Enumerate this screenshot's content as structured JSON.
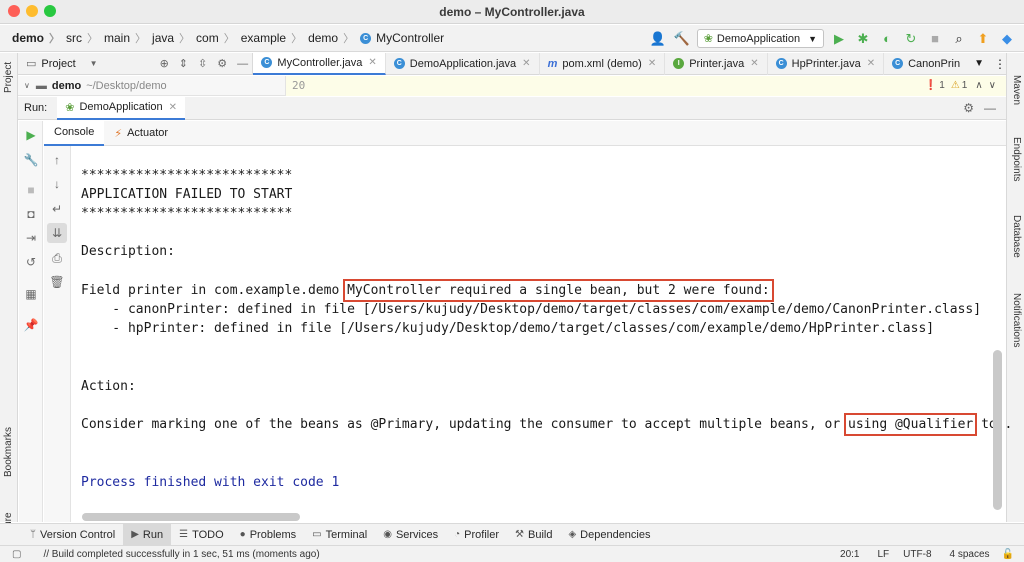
{
  "window": {
    "title": "demo – MyController.java"
  },
  "breadcrumb": [
    "demo",
    "src",
    "main",
    "java",
    "com",
    "example",
    "demo",
    "MyController"
  ],
  "run_config": {
    "label": "DemoApplication"
  },
  "project_panel": {
    "label": "Project",
    "root_name": "demo",
    "root_path": "~/Desktop/demo"
  },
  "editor_tabs": [
    {
      "label": "MyController.java",
      "icon": "C",
      "color": "#3b8fd6",
      "active": true
    },
    {
      "label": "DemoApplication.java",
      "icon": "C",
      "color": "#3b8fd6",
      "active": false
    },
    {
      "label": "pom.xml (demo)",
      "icon": "m",
      "color": "#3b6fd6",
      "active": false
    },
    {
      "label": "Printer.java",
      "icon": "I",
      "color": "#5aa83f",
      "active": false
    },
    {
      "label": "HpPrinter.java",
      "icon": "C",
      "color": "#3b8fd6",
      "active": false
    },
    {
      "label": "CanonPrin",
      "icon": "C",
      "color": "#3b8fd6",
      "active": false
    }
  ],
  "editor": {
    "line_number": "20",
    "errors": "1",
    "warnings": "1"
  },
  "run_panel": {
    "label": "Run:",
    "tab": "DemoApplication",
    "console_tab": "Console",
    "actuator_tab": "Actuator"
  },
  "console": {
    "lines": {
      "stars1": "***************************",
      "failed": "APPLICATION FAILED TO START",
      "stars2": "***************************",
      "desc": "Description:",
      "field_prefix": "Field printer in com.example.demo ",
      "field_highlight": "MyController required a single bean, but 2 were found:",
      "canon": "    - canonPrinter: defined in file [/Users/kujudy/Desktop/demo/target/classes/com/example/demo/CanonPrinter.class]",
      "hp": "    - hpPrinter: defined in file [/Users/kujudy/Desktop/demo/target/classes/com/example/demo/HpPrinter.class]",
      "action": "Action:",
      "consider_prefix": "Consider marking one of the beans as @Primary, updating the consumer to accept multiple beans, or ",
      "consider_highlight": "using @Qualifier",
      "consider_suffix": " to .",
      "process": "Process finished with exit code 1"
    }
  },
  "side_tabs": {
    "left": [
      "Project",
      "Bookmarks",
      "Structure"
    ],
    "right": [
      "Maven",
      "Endpoints",
      "Database",
      "Notifications"
    ]
  },
  "bottom_tabs": [
    "Version Control",
    "Run",
    "TODO",
    "Problems",
    "Terminal",
    "Services",
    "Profiler",
    "Build",
    "Dependencies"
  ],
  "status": {
    "message": "// Build completed successfully in 1 sec, 51 ms (moments ago)",
    "position": "20:1",
    "line_ending": "LF",
    "encoding": "UTF-8",
    "indent": "4 spaces"
  },
  "colors": {
    "highlight_box": "#d84932",
    "process_text": "#1e2aa0",
    "active_tab_underline": "#3c7bd6"
  }
}
